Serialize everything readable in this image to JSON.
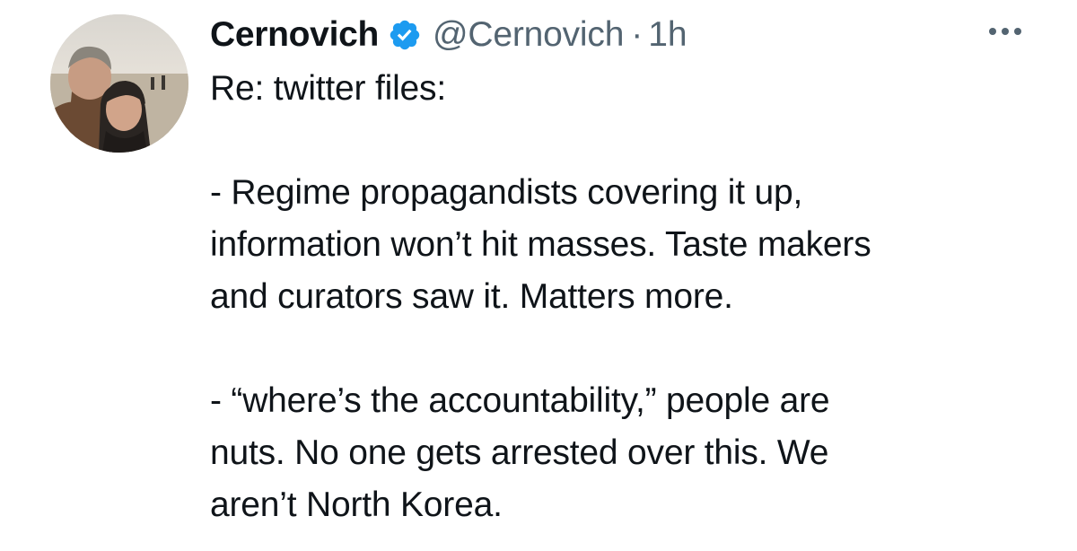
{
  "tweet": {
    "author": {
      "display_name": "Cernovich",
      "handle": "@Cernovich",
      "verified_icon": "verified-badge-icon",
      "avatar_icon": "profile-photo-avatar"
    },
    "separator": "·",
    "timestamp": "1h",
    "more_icon": "more-options-icon",
    "text_lines": [
      "Re: twitter files:",
      "",
      "- Regime propagandists covering it up,",
      "information won’t hit masses. Taste makers",
      "and curators saw it. Matters more.",
      "",
      "- “where’s the accountability,” people are",
      "nuts. No one gets arrested over this. We",
      "aren’t North Korea."
    ]
  },
  "colors": {
    "primary_text": "#0f1419",
    "secondary_text": "#536471",
    "verified_blue": "#1d9bf0",
    "background": "#ffffff"
  }
}
